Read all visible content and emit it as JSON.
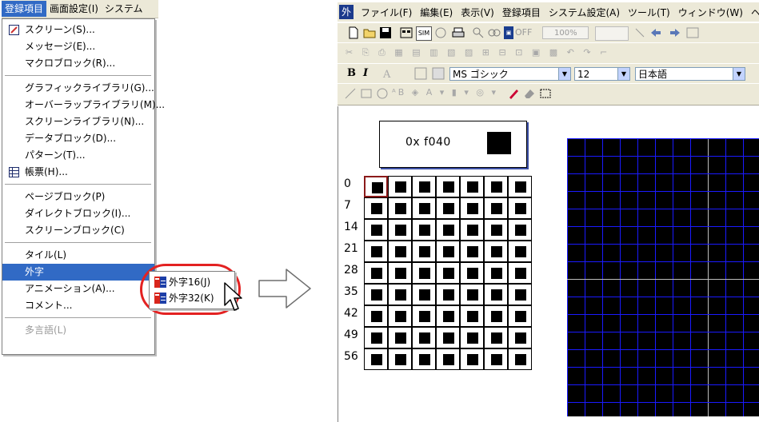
{
  "left_menu": {
    "menubar": [
      "登録項目",
      "画面設定(I)",
      "システム"
    ],
    "active_menubar_index": 0,
    "items": [
      {
        "label": "スクリーン(S)...",
        "icon": "screen-icon"
      },
      {
        "label": "メッセージ(E)..."
      },
      {
        "label": "マクロブロック(R)..."
      },
      {
        "separator": true
      },
      {
        "label": "グラフィックライブラリ(G)..."
      },
      {
        "label": "オーバーラップライブラリ(M)..."
      },
      {
        "label": "スクリーンライブラリ(N)..."
      },
      {
        "label": "データブロック(D)..."
      },
      {
        "label": "パターン(T)..."
      },
      {
        "label": "帳票(H)...",
        "icon": "form-table-icon"
      },
      {
        "separator": true
      },
      {
        "label": "ページブロック(P)"
      },
      {
        "label": "ダイレクトブロック(I)..."
      },
      {
        "label": "スクリーンブロック(C)"
      },
      {
        "separator": true
      },
      {
        "label": "タイル(L)"
      },
      {
        "label": "外字",
        "highlight": true
      },
      {
        "label": "アニメーション(A)..."
      },
      {
        "label": "コメント..."
      },
      {
        "separator": true
      },
      {
        "label": "多言語(L)",
        "disabled": true
      }
    ],
    "submenu": [
      {
        "label": "外字16(J)",
        "icon": "gaiji-16-icon"
      },
      {
        "label": "外字32(K)",
        "icon": "gaiji-32-icon"
      }
    ],
    "highlight_color": "#316ac5",
    "callout_color": "#e32222"
  },
  "right_app": {
    "app_icon": "外",
    "menubar": [
      "ファイル(F)",
      "編集(E)",
      "表示(V)",
      "登録項目",
      "システム設定(A)",
      "ツール(T)",
      "ウィンドウ(W)",
      "ヘ"
    ],
    "toolbar1": {
      "sim_label": "SIM",
      "off_label": "OFF",
      "zoom_value": "100%"
    },
    "format_toolbar": {
      "bold": "B",
      "italic": "I",
      "font_name": "MS ゴシック",
      "font_size": "12",
      "language": "日本語"
    },
    "code_box": {
      "code": "0x f040"
    },
    "row_labels": [
      "0",
      "7",
      "14",
      "21",
      "28",
      "35",
      "42",
      "49",
      "56"
    ],
    "grid_columns": 7,
    "grid_rows": 9,
    "selected_cell_index": 0,
    "editor_grid_color": "#1a1aff",
    "editor_background": "#000000"
  }
}
